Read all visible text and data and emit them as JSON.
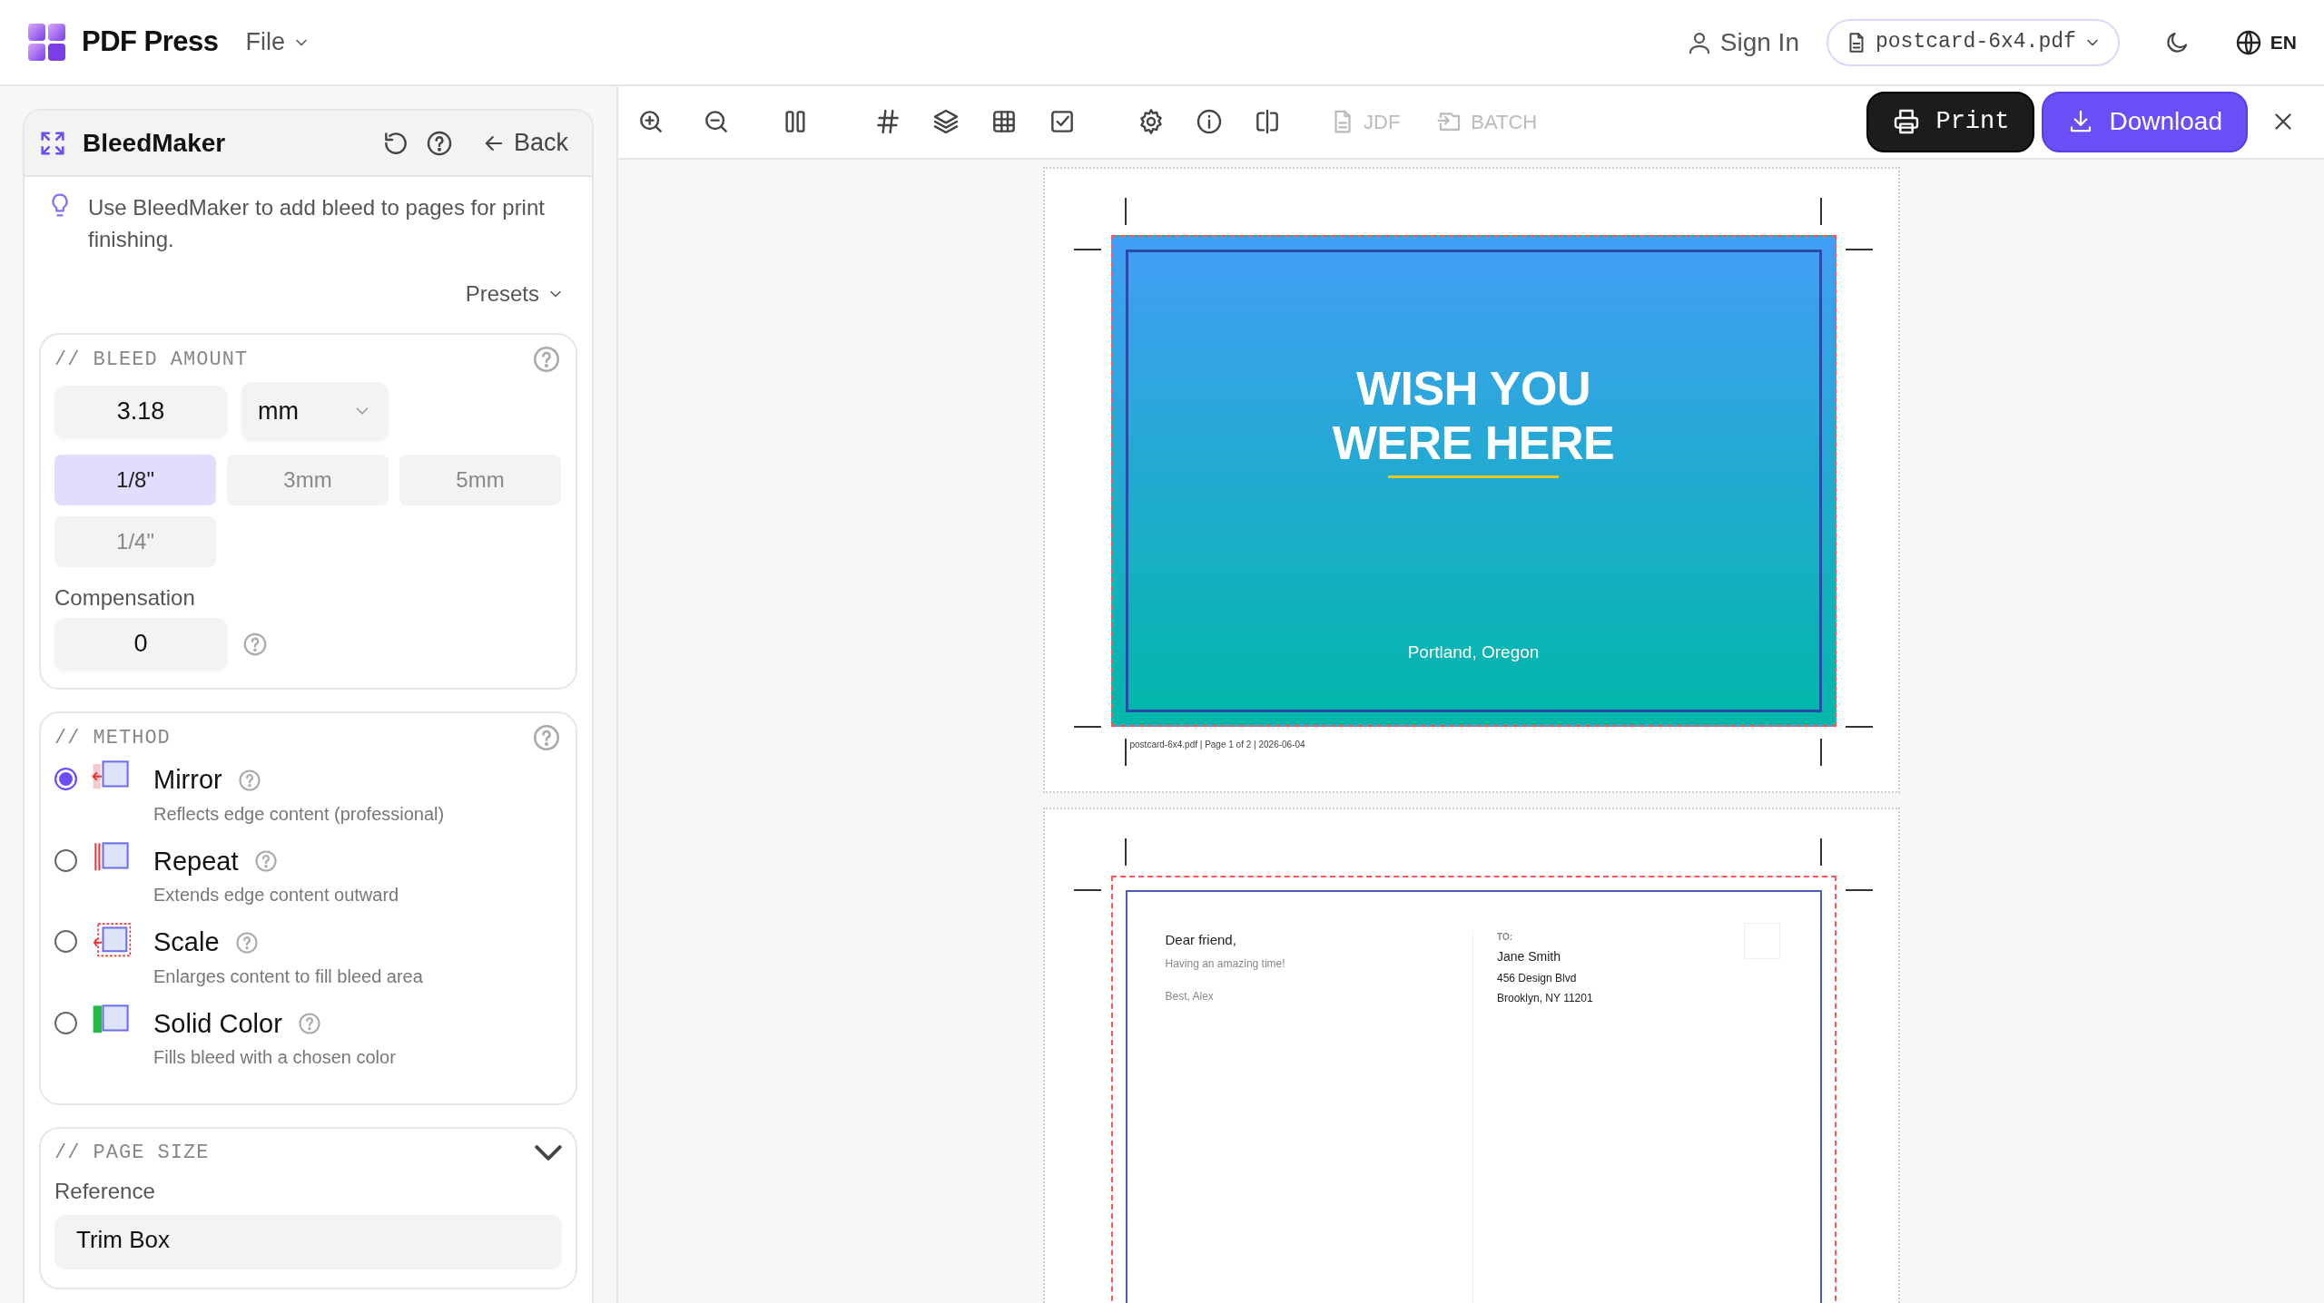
{
  "app": {
    "name": "PDF Press",
    "menu": "File"
  },
  "header": {
    "sign_in": "Sign In",
    "file": "postcard-6x4.pdf",
    "language": "EN"
  },
  "toolbar": {
    "text_tools": [
      {
        "label": "JDF",
        "disabled": true
      },
      {
        "label": "BATCH",
        "disabled": true
      }
    ],
    "print": "Print",
    "download": "Download"
  },
  "panel": {
    "title": "BleedMaker",
    "back": "Back",
    "hint": "Use BleedMaker to add bleed to pages for print finishing.",
    "presets": "Presets"
  },
  "bleed_amount": {
    "title": "// BLEED AMOUNT",
    "value": "3.18",
    "unit": "mm",
    "presets": [
      {
        "label": "1/8\"",
        "selected": true
      },
      {
        "label": "3mm",
        "selected": false
      },
      {
        "label": "5mm",
        "selected": false
      },
      {
        "label": "1/4\"",
        "selected": false
      }
    ],
    "compensation_label": "Compensation",
    "compensation": "0"
  },
  "method": {
    "title": "// METHOD",
    "options": [
      {
        "kind": "mirror",
        "label": "Mirror",
        "description": "Reflects edge content (professional)",
        "selected": true
      },
      {
        "kind": "repeat",
        "label": "Repeat",
        "description": "Extends edge content outward",
        "selected": false
      },
      {
        "kind": "scale",
        "label": "Scale",
        "description": "Enlarges content to fill bleed area",
        "selected": false
      },
      {
        "kind": "solid",
        "label": "Solid Color",
        "description": "Fills bleed with a chosen color",
        "selected": false
      }
    ]
  },
  "page_size": {
    "title": "// PAGE SIZE",
    "expanded": true,
    "reference_label": "Reference",
    "reference": "Trim Box"
  },
  "pages": [
    {
      "kind": "front",
      "title_lines": [
        "WISH YOU",
        "WERE HERE"
      ],
      "caption": "Portland, Oregon",
      "slug": "postcard-6x4.pdf | Page 1 of 2 | 2026-06-04"
    },
    {
      "kind": "back",
      "greeting": "Dear friend,",
      "message": "Having an amazing time!",
      "signoff": "Best, Alex",
      "to_label": "TO:",
      "name": "Jane Smith",
      "address_lines": [
        "456 Design Blvd",
        "Brooklyn, NY 11201"
      ]
    }
  ]
}
